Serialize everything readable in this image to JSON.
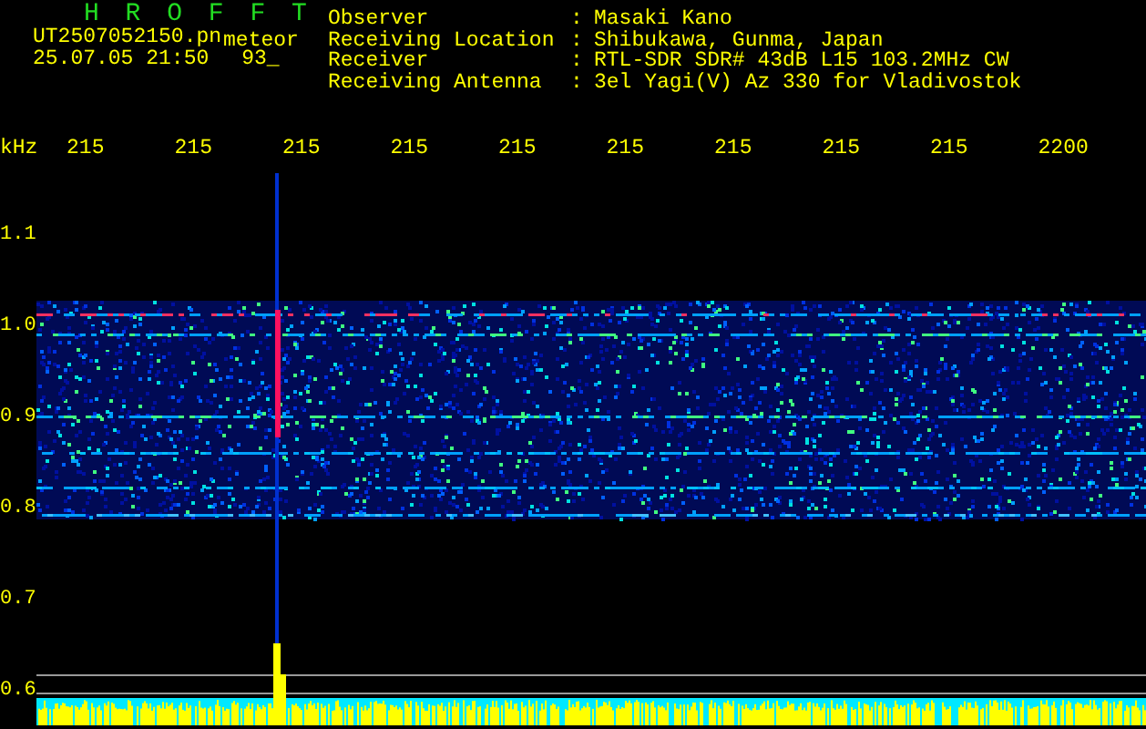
{
  "header": {
    "title": "H R O F F T",
    "filename": "UT2507052150.pn",
    "tag": "meteor",
    "datetime": "25.07.05 21:50",
    "count": "93_"
  },
  "station_info": [
    {
      "label": "Observer",
      "separator": ":",
      "value": "Masaki Kano"
    },
    {
      "label": "Receiving Location",
      "separator": ":",
      "value": "Shibukawa, Gunma, Japan"
    },
    {
      "label": "Receiver",
      "separator": ":",
      "value": "RTL-SDR SDR# 43dB L15 103.2MHz CW"
    },
    {
      "label": "Receiving Antenna",
      "separator": ":",
      "value": "3el Yagi(V) Az 330 for Vladivostok"
    }
  ],
  "x_axis": {
    "unit": "kHz",
    "labels": [
      "215",
      "215",
      "215",
      "215",
      "215",
      "215",
      "215",
      "215",
      "215",
      "2200"
    ]
  },
  "y_axis": {
    "labels": [
      "1.1",
      "1.0",
      "0.9",
      "0.8",
      "0.7",
      "0.6"
    ]
  }
}
